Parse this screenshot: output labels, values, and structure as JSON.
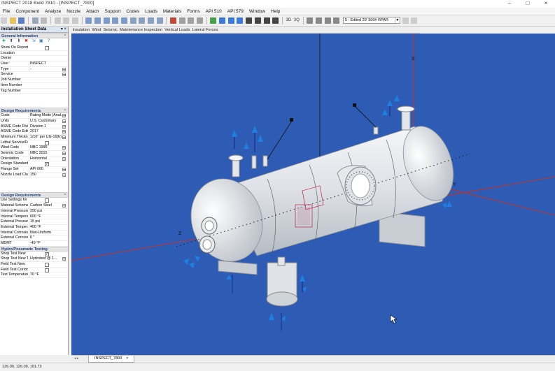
{
  "window": {
    "title": "INSPECT 2018 Build 7810 - [INSPECT_7800]"
  },
  "menu": [
    "File",
    "Component",
    "Analyze",
    "Nozzle",
    "Attach",
    "Support",
    "Codes",
    "Loads",
    "Materials",
    "Forms",
    "API 510",
    "API 579",
    "Window",
    "Help"
  ],
  "toolbar": {
    "zoom_1": "3D",
    "zoom_2": "3Q",
    "view_combo": "5 : Edited 29' 500# RPAR"
  },
  "panel": {
    "title": "Installation Sheet Data",
    "sections": {
      "general": "General Information",
      "design": "Design Requirements",
      "design2": "Design Requirements",
      "hydro": "Hydro/Pneumatic Testing"
    },
    "general_rows": [
      {
        "label": "Show On Report C...",
        "value": "",
        "control": "checkbox",
        "checked": false
      },
      {
        "label": "Location",
        "value": "",
        "control": ""
      },
      {
        "label": "Owner",
        "value": "",
        "control": ""
      },
      {
        "label": "User",
        "value": "INSPECT",
        "control": ""
      },
      {
        "label": "Type",
        "value": "-",
        "control": "dropdown"
      },
      {
        "label": "Service",
        "value": "",
        "control": "dropdown"
      },
      {
        "label": "Job Number",
        "value": "",
        "control": ""
      },
      {
        "label": "Item Number",
        "value": "",
        "control": ""
      },
      {
        "label": "Tag Number",
        "value": "",
        "control": ""
      }
    ],
    "design_rows": [
      {
        "label": "Code",
        "value": "Rating Mode (Anal...",
        "control": "dropdown"
      },
      {
        "label": "Units",
        "value": "U.S. Customary",
        "control": "dropdown"
      },
      {
        "label": "ASME Code Division",
        "value": "Division 1",
        "control": "dropdown"
      },
      {
        "label": "ASME Code Edition",
        "value": "2017",
        "control": "dropdown"
      },
      {
        "label": "Minimum Thickness",
        "value": "1/16\" per UG-16(b)",
        "control": "dropdown"
      },
      {
        "label": "Lethal Service/Full...",
        "value": "",
        "control": "checkbox",
        "checked": false
      },
      {
        "label": "Wind Code",
        "value": "NBC 1995",
        "control": "dropdown"
      },
      {
        "label": "Seismic Code",
        "value": "NBC 2015",
        "control": "dropdown"
      },
      {
        "label": "Orientation",
        "value": "Horizontal",
        "control": "dropdown"
      },
      {
        "label": "Design Standard No...",
        "value": "",
        "control": "checkbox",
        "checked": true
      },
      {
        "label": "Flange Set",
        "value": "API 660",
        "control": "dropdown"
      },
      {
        "label": "Nozzle Load Class",
        "value": "150",
        "control": "dropdown"
      }
    ],
    "design2_rows": [
      {
        "label": "Use Settings for Indiv...",
        "value": "",
        "control": "checkbox",
        "checked": false
      },
      {
        "label": "Material Scheme",
        "value": "Carbon Steel",
        "control": "dropdown"
      },
      {
        "label": "Internal Pressure",
        "value": "250 psi",
        "control": ""
      },
      {
        "label": "Internal Temperature",
        "value": "600 °F",
        "control": ""
      },
      {
        "label": "External Pressure",
        "value": "15 psi",
        "control": ""
      },
      {
        "label": "External Temperature",
        "value": "400 °F",
        "control": ""
      },
      {
        "label": "Internal Corrosion",
        "value": "Non-Uniform",
        "control": ""
      },
      {
        "label": "External Corrosion",
        "value": "0 \"",
        "control": ""
      },
      {
        "label": "MDMT",
        "value": "-49 °F",
        "control": ""
      }
    ],
    "hydro_rows": [
      {
        "label": "Shop Test New",
        "value": "",
        "control": "checkbox",
        "checked": true
      },
      {
        "label": "Shop Test New Te...",
        "value": "Hydrotest @ 1...",
        "control": "dropdown"
      },
      {
        "label": "Field Test New",
        "value": "",
        "control": "checkbox",
        "checked": false
      },
      {
        "label": "Field Test Corroded",
        "value": "",
        "control": "checkbox",
        "checked": false
      },
      {
        "label": "Test Temperature",
        "value": "70 °F",
        "control": ""
      }
    ]
  },
  "view_tabs": [
    "Insulation",
    "Wind",
    "Seismic",
    "Maintenance Inspection",
    "Vertical Loads",
    "Lateral Forces"
  ],
  "axes": {
    "x": "X",
    "y": "Y",
    "z": "Z"
  },
  "document_tab": "INSPECT_7800",
  "status": "126.00, 126.09, 191.73",
  "colors": {
    "viewport_bg": "#2e5bb3",
    "axis": "#c0332b",
    "load_arrow": "#1e7fe0",
    "vessel": "#e9ecef"
  }
}
